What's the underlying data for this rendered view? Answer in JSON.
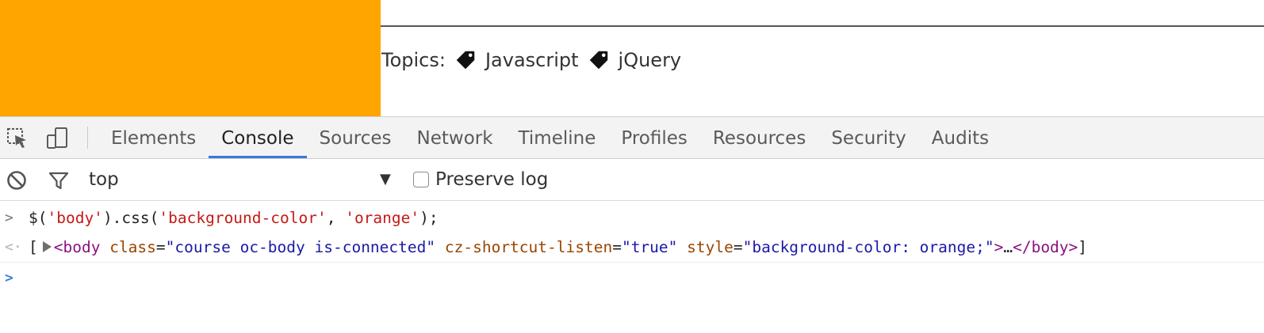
{
  "page": {
    "background_color": "#ffa500",
    "topics_label": "Topics:",
    "topics": [
      {
        "icon": "tag-icon",
        "label": "Javascript"
      },
      {
        "icon": "tag-icon",
        "label": "jQuery"
      }
    ]
  },
  "devtools": {
    "toolbar_icons": [
      "inspect-element-icon",
      "device-mode-icon"
    ],
    "tabs": [
      "Elements",
      "Console",
      "Sources",
      "Network",
      "Timeline",
      "Profiles",
      "Resources",
      "Security",
      "Audits"
    ],
    "active_tab": "Console",
    "accent_color": "#3879d9",
    "filter": {
      "clear_icon": "clear-console-icon",
      "filter_icon": "filter-icon",
      "context": "top",
      "context_arrow": "▼",
      "preserve_log_label": "Preserve log",
      "preserve_log_checked": false
    },
    "console": {
      "input_prompt": ">",
      "output_prompt": "<·",
      "command": {
        "p1": "$(",
        "s1": "'body'",
        "p2": ").css(",
        "s2": "'background-color'",
        "p3": ", ",
        "s3": "'orange'",
        "p4": ");"
      },
      "result": {
        "open_bracket": "[",
        "tag_open": "<body",
        "attr1_name": "class",
        "attr1_value": "\"course oc-body is-connected\"",
        "attr2_name": "cz-shortcut-listen",
        "attr2_value": "\"true\"",
        "attr3_name": "style",
        "attr3_value": "\"background-color: orange;\"",
        "tag_close_open": ">",
        "ellipsis": "…",
        "tag_end": "</body>",
        "close_bracket": "]",
        "eq": "="
      },
      "prompt_caret": ">"
    }
  }
}
